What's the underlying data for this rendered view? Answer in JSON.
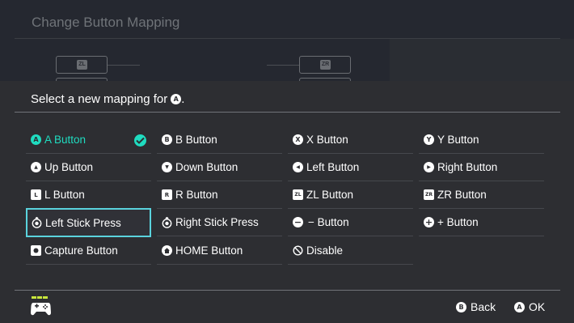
{
  "background": {
    "title": "Change Button Mapping",
    "left_box_label": "ZL",
    "right_box_label": "ZR"
  },
  "dialog": {
    "prompt": "Select a new mapping for",
    "prompt_glyph": "A",
    "prompt_suffix": ".",
    "accent_color": "#1fdcc0",
    "selection_color": "#5ad3dd"
  },
  "options": [
    [
      {
        "glyph": "A",
        "label": "A Button",
        "state": "current"
      },
      {
        "glyph": "B",
        "label": "B Button"
      },
      {
        "glyph": "X",
        "label": "X Button"
      },
      {
        "glyph": "Y",
        "label": "Y Button"
      }
    ],
    [
      {
        "glyph": "▲",
        "label": "Up Button"
      },
      {
        "glyph": "▼",
        "label": "Down Button"
      },
      {
        "glyph": "◀",
        "label": "Left Button"
      },
      {
        "glyph": "▶",
        "label": "Right Button"
      }
    ],
    [
      {
        "glyph": "L",
        "label": "L Button"
      },
      {
        "glyph": "R",
        "label": "R Button"
      },
      {
        "glyph": "ZL",
        "label": "ZL Button"
      },
      {
        "glyph": "ZR",
        "label": "ZR Button"
      }
    ],
    [
      {
        "glyph": "stick",
        "label": "Left Stick Press",
        "state": "focused"
      },
      {
        "glyph": "stick",
        "label": "Right Stick Press"
      },
      {
        "glyph": "−",
        "label": "− Button"
      },
      {
        "glyph": "+",
        "label": "+ Button"
      }
    ],
    [
      {
        "glyph": "capture",
        "label": "Capture Button"
      },
      {
        "glyph": "home",
        "label": "HOME Button"
      },
      {
        "glyph": "⃠",
        "label": "Disable"
      }
    ]
  ],
  "footer": {
    "back_glyph": "B",
    "back_label": "Back",
    "ok_glyph": "A",
    "ok_label": "OK"
  }
}
